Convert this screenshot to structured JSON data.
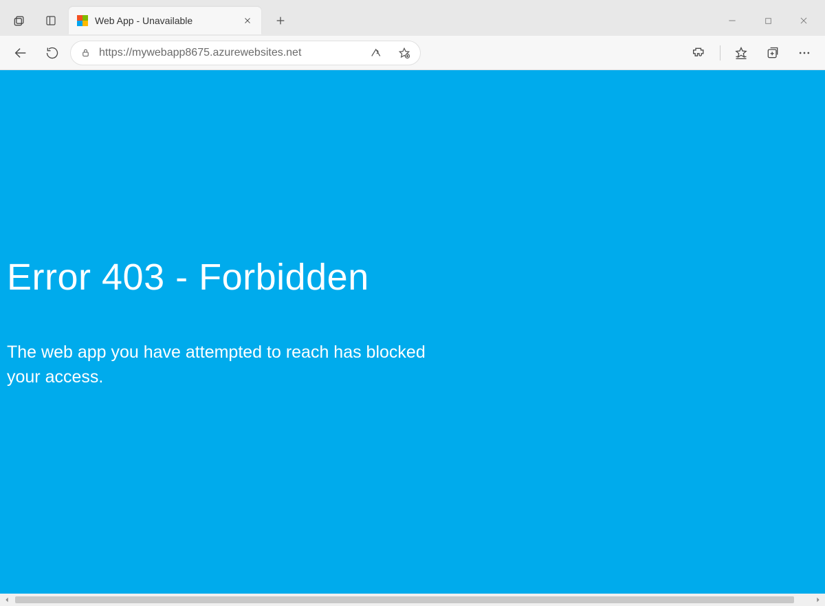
{
  "tab": {
    "title": "Web App - Unavailable"
  },
  "address": {
    "url": "https://mywebapp8675.azurewebsites.net"
  },
  "page": {
    "heading": "Error 403 - Forbidden",
    "message": "The web app you have attempted to reach has blocked your access."
  },
  "colors": {
    "page_bg": "#00abec",
    "page_fg": "#ffffff"
  }
}
